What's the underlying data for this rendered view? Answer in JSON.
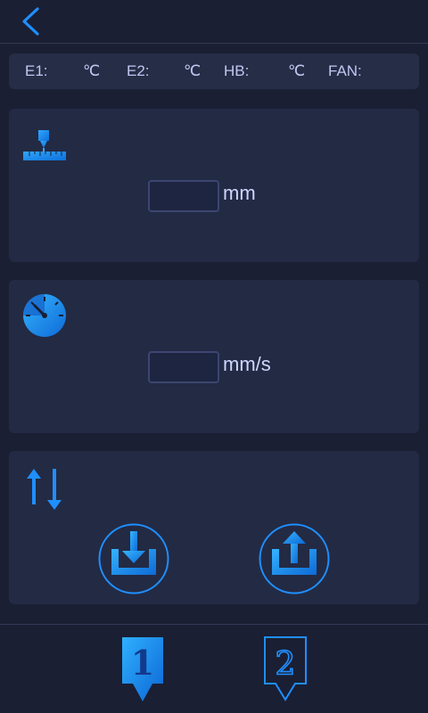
{
  "nav": {
    "back_icon": "chevron-left-icon"
  },
  "status": {
    "e1_label": "E1:",
    "e1_unit": "℃",
    "e2_label": "E2:",
    "e2_unit": "℃",
    "hb_label": "HB:",
    "hb_unit": "℃",
    "fan_label": "FAN:"
  },
  "move": {
    "icon": "nozzle-ruler-icon",
    "distance_value": "",
    "unit": "mm"
  },
  "speed": {
    "icon": "speedometer-icon",
    "speed_value": "",
    "unit": "mm/s"
  },
  "direction": {
    "icon": "up-down-arrows-icon",
    "load_icon": "load-filament-icon",
    "unload_icon": "unload-filament-icon"
  },
  "extruders": {
    "tab1_label": "1",
    "tab2_label": "2",
    "selected": "1"
  },
  "colors": {
    "background": "#1a1f33",
    "panel": "#232a44",
    "accent": "#1f8fff",
    "text": "#c7cff5"
  }
}
